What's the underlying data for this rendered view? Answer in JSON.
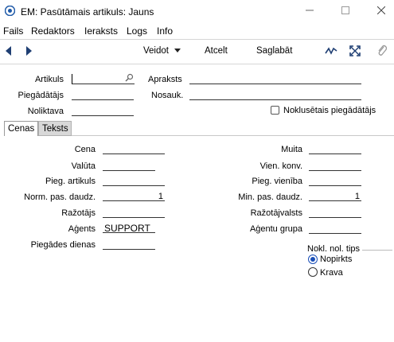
{
  "window": {
    "title": "EM: Pasūtāmais artikuls: Jauns",
    "min_icon": "minimize-icon",
    "max_icon": "maximize-icon",
    "close_icon": "close-icon"
  },
  "menu": {
    "items": [
      "Fails",
      "Redaktors",
      "Ieraksts",
      "Logs",
      "Info"
    ]
  },
  "toolbar": {
    "back_icon": "arrow-left-icon",
    "forward_icon": "arrow-right-icon",
    "operations_label": "Veidot",
    "cancel_label": "Atcelt",
    "save_label": "Saglabāt",
    "signature_icon": "signature-icon",
    "expand_icon": "expand-icon",
    "attachment_icon": "paperclip-icon"
  },
  "header": {
    "artikuls_label": "Artikuls",
    "artikuls_value": "",
    "apraksts_label": "Apraksts",
    "apraksts_value": "",
    "piegadatajs_label": "Piegādātājs",
    "piegadatajs_value": "",
    "nosauk_label": "Nosauk.",
    "nosauk_value": "",
    "noliktava_label": "Noliktava",
    "noliktava_value": "",
    "default_supplier_label": "Noklusētais piegādātājs",
    "default_supplier_checked": false
  },
  "tabs": [
    {
      "label": "Cenas",
      "active": true
    },
    {
      "label": "Teksts",
      "active": false
    }
  ],
  "cenas": {
    "left": [
      {
        "label": "Cena",
        "value": ""
      },
      {
        "label": "Valūta",
        "value": ""
      },
      {
        "label": "Pieg. artikuls",
        "value": ""
      },
      {
        "label": "Norm. pas. daudz.",
        "value": "1"
      },
      {
        "label": "Ražotājs",
        "value": ""
      },
      {
        "label": "Aģents",
        "value": "SUPPORT"
      },
      {
        "label": "Piegādes dienas",
        "value": ""
      }
    ],
    "right": [
      {
        "label": "Muita",
        "value": ""
      },
      {
        "label": "Vien. konv.",
        "value": ""
      },
      {
        "label": "Pieg. vienība",
        "value": ""
      },
      {
        "label": "Min. pas. daudz.",
        "value": "1"
      },
      {
        "label": "Ražotājvalsts",
        "value": ""
      },
      {
        "label": "Aģentu grupa",
        "value": ""
      }
    ],
    "order_type": {
      "title": "Nokl. nol. tips",
      "options": [
        "Nopirkts",
        "Krava"
      ],
      "selected": "Nopirkts"
    }
  },
  "colors": {
    "accent": "#1a4fb8",
    "tab_inactive": "#d8d8d8"
  }
}
